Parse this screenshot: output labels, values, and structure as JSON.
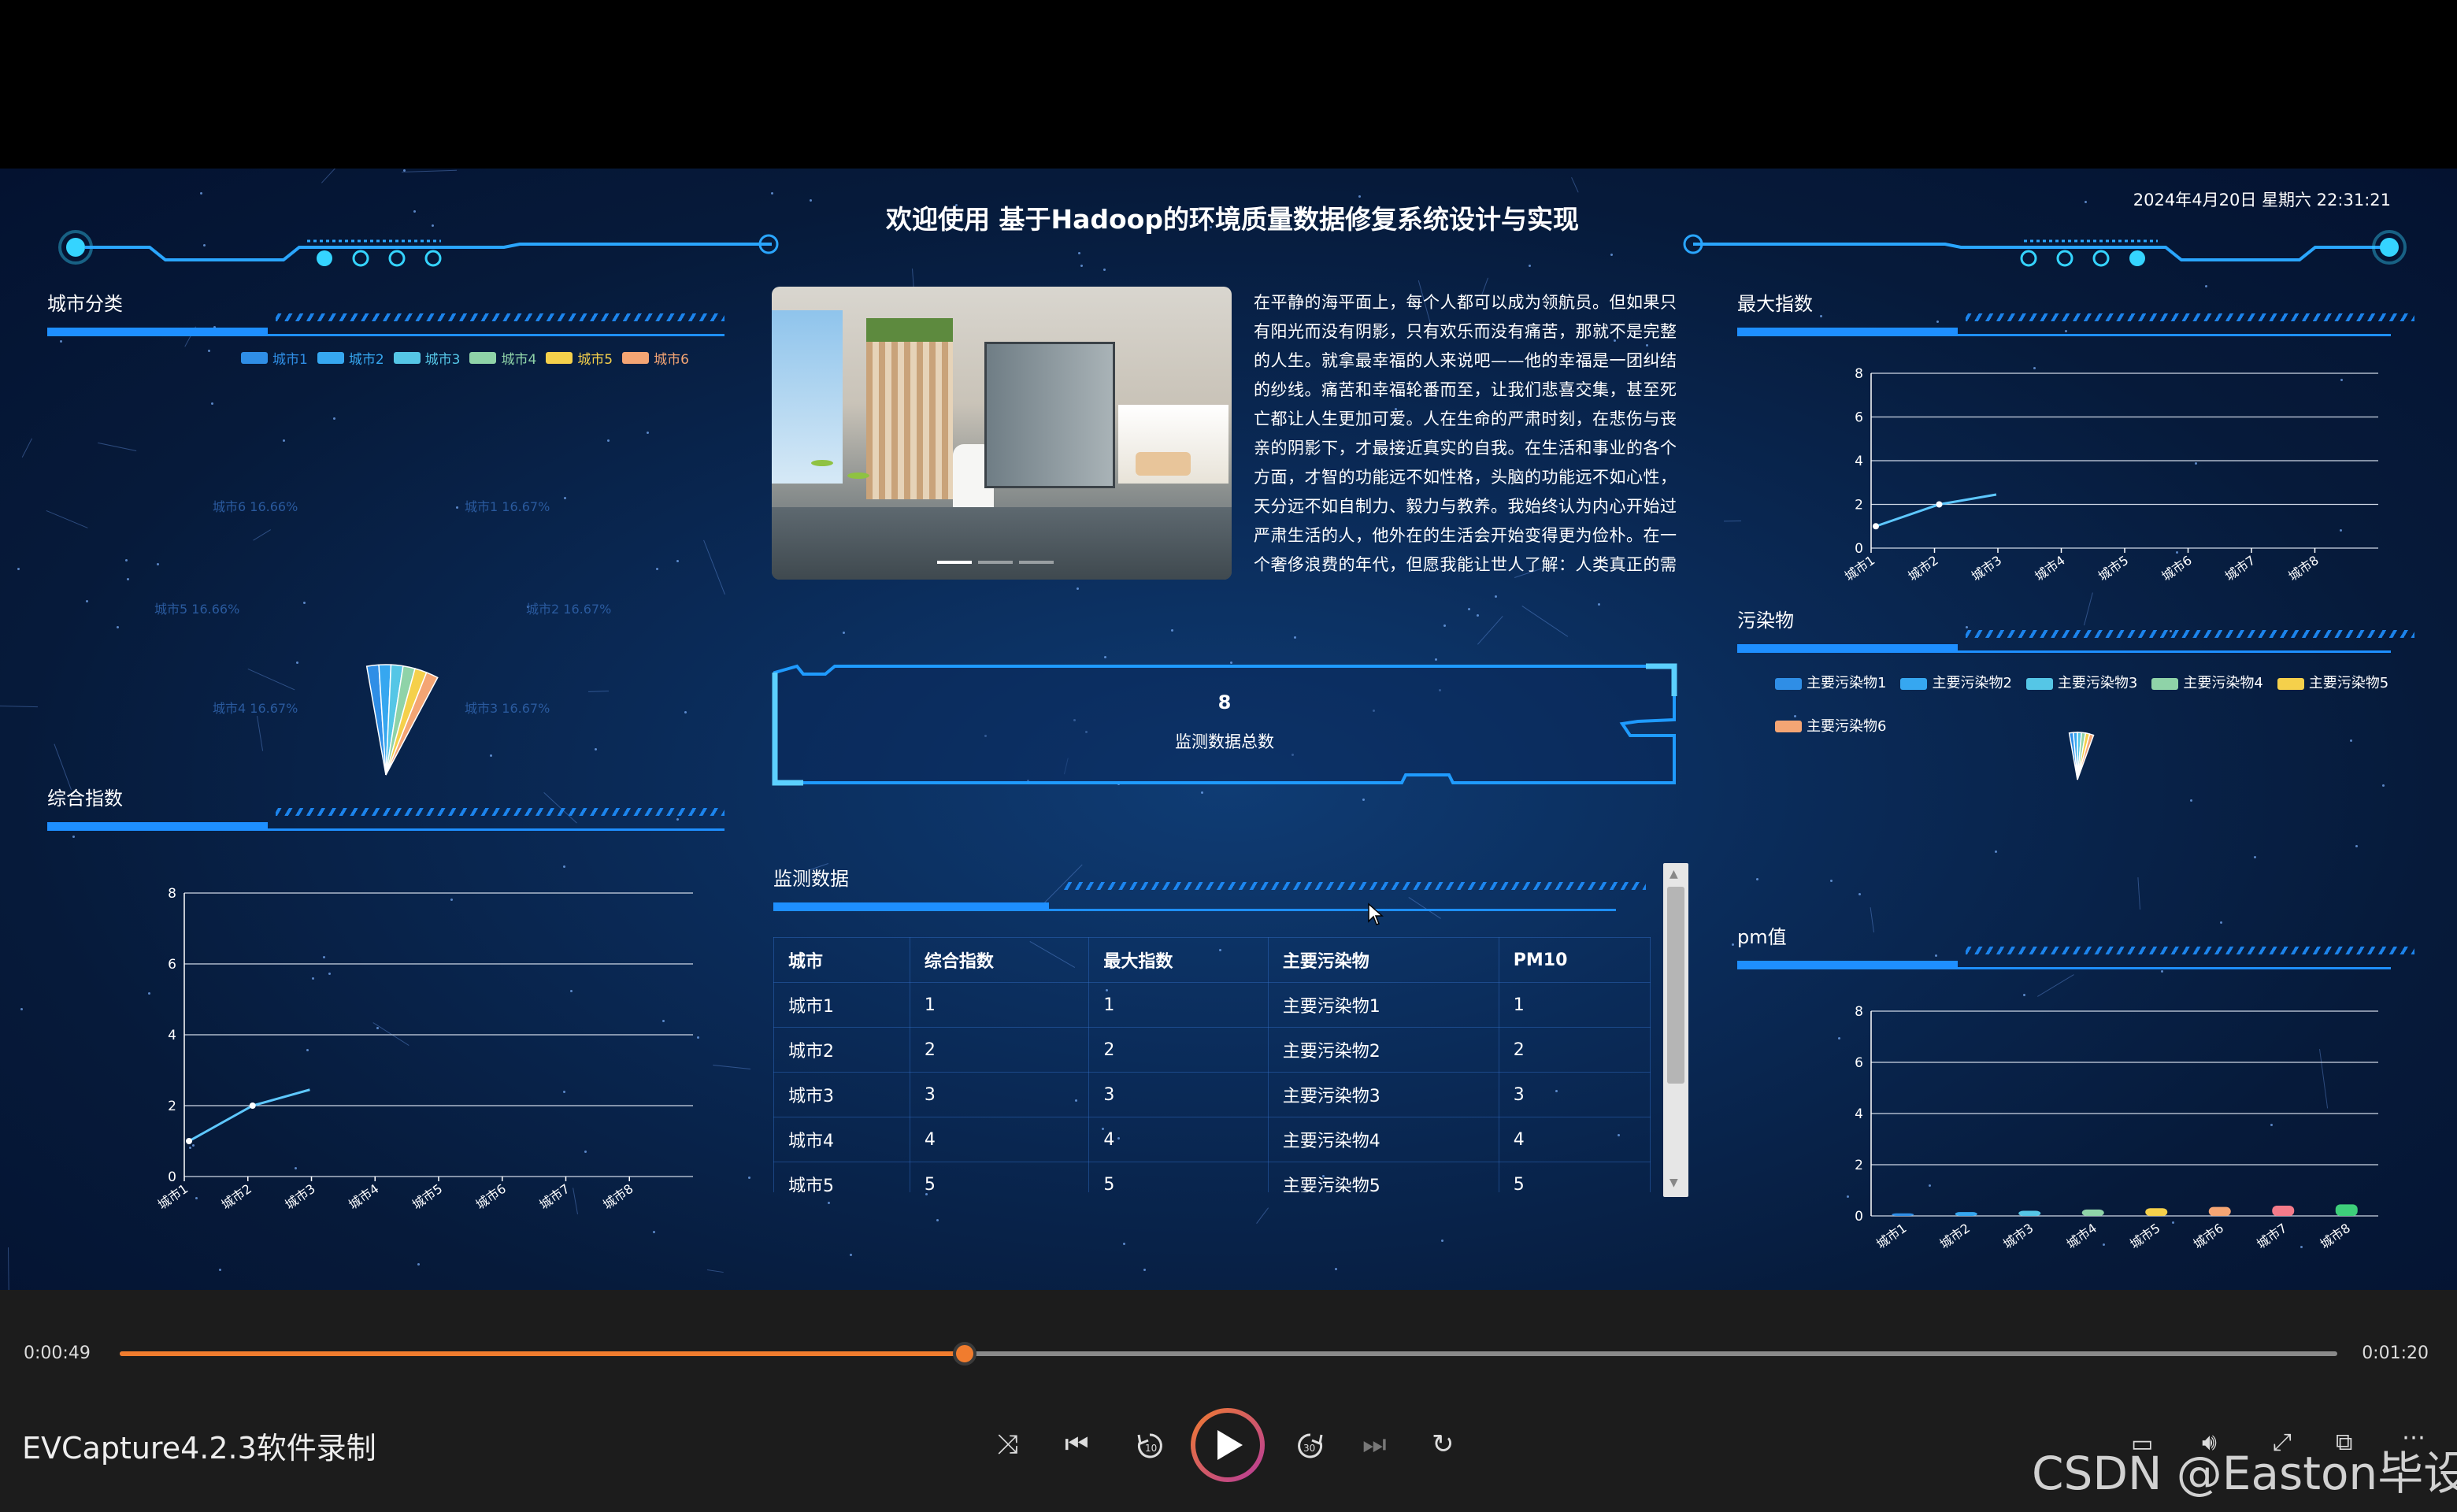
{
  "header": {
    "title": "欢迎使用 基于Hadoop的环境质量数据修复系统设计与实现",
    "datetime": "2024年4月20日 星期六 22:31:21"
  },
  "city_panel": {
    "title": "城市分类",
    "legend": [
      "城市1",
      "城市2",
      "城市3",
      "城市4",
      "城市5",
      "城市6"
    ],
    "legend_colors": [
      "#2f8ee6",
      "#36a7f0",
      "#55c6e6",
      "#8fd3a8",
      "#f5d04b",
      "#f4a574"
    ],
    "pie_labels": [
      "城市6 16.66%",
      "城市1 16.67%",
      "城市5 16.66%",
      "城市2 16.67%",
      "城市4 16.67%",
      "城市3 16.67%"
    ]
  },
  "composite_panel": {
    "title": "综合指数",
    "chart_data": {
      "type": "line",
      "categories": [
        "城市1",
        "城市2",
        "城市3",
        "城市4",
        "城市5",
        "城市6",
        "城市7",
        "城市8"
      ],
      "values": [
        1,
        2
      ],
      "ylim": [
        0,
        8
      ],
      "yticks": [
        "0",
        "2",
        "4",
        "6",
        "8"
      ]
    }
  },
  "center": {
    "description": "在平静的海平面上，每个人都可以成为领航员。但如果只有阳光而没有阴影，只有欢乐而没有痛苦，那就不是完整的人生。就拿最幸福的人来说吧——他的幸福是一团纠结的纱线。痛苦和幸福轮番而至，让我们悲喜交集，甚至死亡都让人生更加可爱。人在生命的严肃时刻，在悲伤与丧亲的阴影下，才最接近真实的自我。在生活和事业的各个方面，才智的功能远不如性格，头脑的功能远不如心性，天分远不如自制力、毅力与教养。我始终认为内心开始过严肃生活的人，他外在的生活会开始变得更为俭朴。在一个奢侈浪费的年代，但愿我能让世人了解：人类真正的需",
    "total_value": "8",
    "total_label": "监测数据总数"
  },
  "monitor": {
    "title": "监测数据",
    "columns": [
      "城市",
      "综合指数",
      "最大指数",
      "主要污染物",
      "PM10"
    ],
    "rows": [
      [
        "城市1",
        "1",
        "1",
        "主要污染物1",
        "1"
      ],
      [
        "城市2",
        "2",
        "2",
        "主要污染物2",
        "2"
      ],
      [
        "城市3",
        "3",
        "3",
        "主要污染物3",
        "3"
      ],
      [
        "城市4",
        "4",
        "4",
        "主要污染物4",
        "4"
      ],
      [
        "城市5",
        "5",
        "5",
        "主要污染物5",
        "5"
      ]
    ]
  },
  "max_panel": {
    "title": "最大指数",
    "chart_data": {
      "type": "line",
      "categories": [
        "城市1",
        "城市2",
        "城市3",
        "城市4",
        "城市5",
        "城市6",
        "城市7",
        "城市8"
      ],
      "values": [
        1,
        2
      ],
      "ylim": [
        0,
        8
      ],
      "yticks": [
        "0",
        "2",
        "4",
        "6",
        "8"
      ]
    }
  },
  "pollutant_panel": {
    "title": "污染物",
    "legend": [
      "主要污染物1",
      "主要污染物2",
      "主要污染物3",
      "主要污染物4",
      "主要污染物5",
      "主要污染物6"
    ],
    "legend_colors": [
      "#2f8ee6",
      "#36a7f0",
      "#55c6e6",
      "#8fd3a8",
      "#f5d04b",
      "#f4a574"
    ]
  },
  "pm_panel": {
    "title": "pm值",
    "chart_data": {
      "type": "bar",
      "categories": [
        "城市1",
        "城市2",
        "城市3",
        "城市4",
        "城市5",
        "城市6",
        "城市7",
        "城市8"
      ],
      "values": [
        0.1,
        0.15,
        0.2,
        0.25,
        0.3,
        0.35,
        0.4,
        0.45
      ],
      "colors": [
        "#2f8ee6",
        "#36a7f0",
        "#55c6e6",
        "#8fd3a8",
        "#f5d04b",
        "#f4a574",
        "#f47b8a",
        "#3ecf7a"
      ],
      "ylim": [
        0,
        8
      ],
      "yticks": [
        "0",
        "2",
        "4",
        "6",
        "8"
      ]
    }
  },
  "player": {
    "current_time": "0:00:49",
    "total_time": "0:01:20",
    "progress": 0.381,
    "caption": "EVCapture4.2.3软件录制",
    "watermark": "CSDN @Easton毕设",
    "accent": "#f07c2e"
  }
}
